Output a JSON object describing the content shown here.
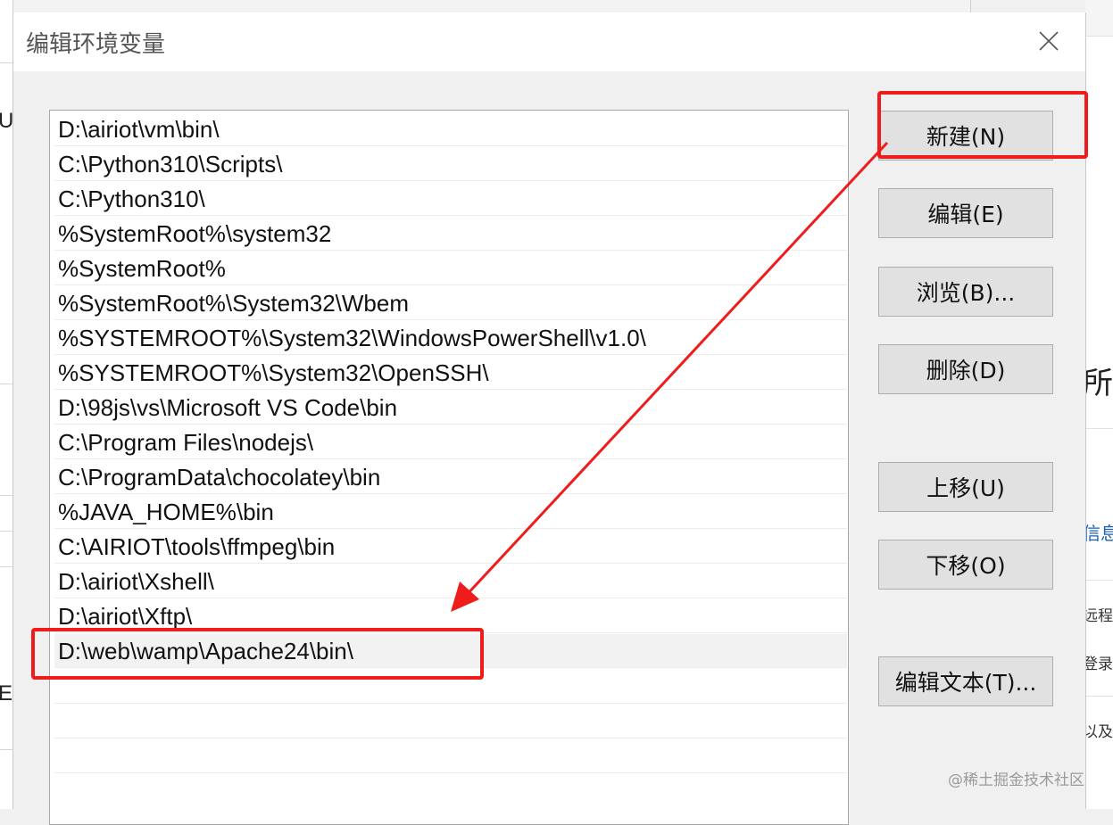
{
  "dialog": {
    "title": "编辑环境变量",
    "close_icon": "close-icon"
  },
  "path_list": {
    "entries": [
      "D:\\airiot\\vm\\bin\\",
      "C:\\Python310\\Scripts\\",
      "C:\\Python310\\",
      "%SystemRoot%\\system32",
      "%SystemRoot%",
      "%SystemRoot%\\System32\\Wbem",
      "%SYSTEMROOT%\\System32\\WindowsPowerShell\\v1.0\\",
      "%SYSTEMROOT%\\System32\\OpenSSH\\",
      "D:\\98js\\vs\\Microsoft VS Code\\bin",
      "C:\\Program Files\\nodejs\\",
      "C:\\ProgramData\\chocolatey\\bin",
      "%JAVA_HOME%\\bin",
      "C:\\AIRIOT\\tools\\ffmpeg\\bin",
      "D:\\airiot\\Xshell\\",
      "D:\\airiot\\Xftp\\",
      "D:\\web\\wamp\\Apache24\\bin\\"
    ],
    "selected_index": 15
  },
  "buttons": {
    "new": "新建(N)",
    "edit": "编辑(E)",
    "browse": "浏览(B)...",
    "delete": "删除(D)",
    "move_up": "上移(U)",
    "move_down": "下移(O)",
    "edit_text": "编辑文本(T)..."
  },
  "background": {
    "left_fragments": [
      "U",
      "E:"
    ],
    "right_fragments": [
      "所",
      "信息",
      "远程",
      "登录",
      "以及"
    ]
  },
  "annotation": {
    "color": "#ef1c1c"
  },
  "watermark": "@稀土掘金技术社区"
}
